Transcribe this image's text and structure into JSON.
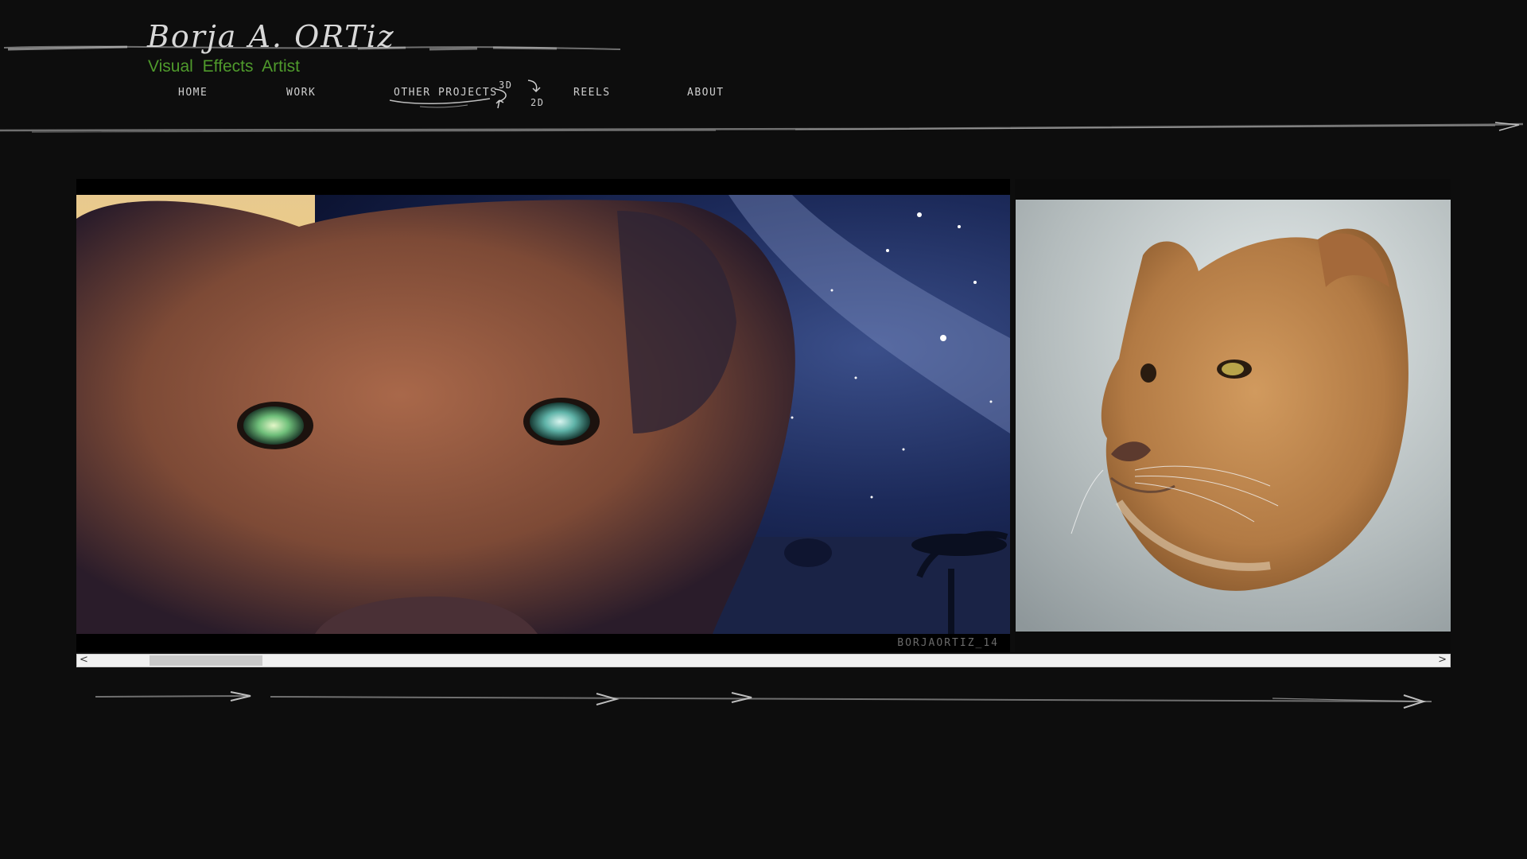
{
  "header": {
    "name": "Borja A. ORTiz",
    "subtitle": "Visual Effects Artist"
  },
  "nav": {
    "home": "HOME",
    "work": "WORK",
    "other_projects": "OTHER PROJECTS",
    "three_d": "3D",
    "two_d": "2D",
    "reels": "REELS",
    "about": "ABOUT"
  },
  "gallery": {
    "slides": [
      {
        "watermark": "BORJAORTIZ_14"
      }
    ],
    "scroll_left": "<",
    "scroll_right": ">"
  },
  "colors": {
    "background": "#0d0d0d",
    "subtitle_green": "#4f9a2c",
    "nav_text": "#cfcfcf"
  }
}
